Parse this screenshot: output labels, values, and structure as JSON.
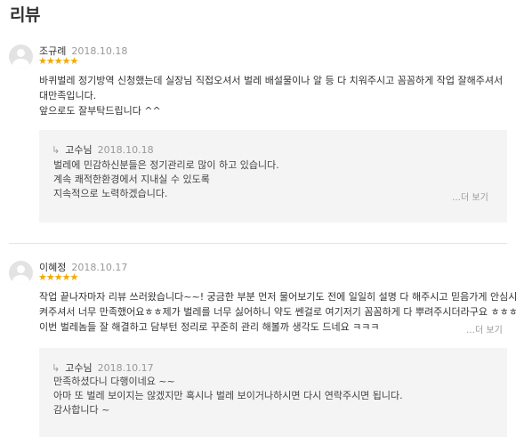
{
  "page": {
    "title": "리뷰"
  },
  "reviews": [
    {
      "author": "조규례",
      "date": "2018.10.18",
      "stars": "★★★★★",
      "lines": [
        "바퀴벌레 정기방역 신청했는데 실장님 직접오셔서 벌레 배설물이나 알 등 다 치워주시고 꼼꼼하게 작업 잘해주셔서",
        "대만족입니다.",
        "앞으로도 잘부탁드립니다 ^^"
      ],
      "reply": {
        "arrow": "↳",
        "author": "고수님",
        "date": "2018.10.18",
        "lines": [
          "벌레에 민감하신분들은 정기관리로 많이 하고 있습니다.",
          "계속 쾌적한환경에서 지내실 수 있도록",
          "지속적으로 노력하겠습니다."
        ],
        "more": "…더 보기"
      }
    },
    {
      "author": "이혜정",
      "date": "2018.10.17",
      "stars": "★★★★★",
      "lines": [
        "작업 끝나자마자 리뷰 쓰러왔습니다~~! 궁금한 부분 먼저 물어보기도 전에 일일히 설명 다 해주시고 믿음가게 안심시",
        "켜주셔서 너무 만족했어요ㅎㅎ제가 벌레를 너무 싫어하니 약도 쎈걸로 여기저기 꼼꼼하게 다 뿌려주시더라구요 ㅎㅎㅎ",
        "이번 벌레놈들 잘 해결하고 담부턴 정리로 꾸준히 관리 해볼까 생각도 드네요 ㅋㅋㅋ"
      ],
      "more": "…더 보기",
      "reply": {
        "arrow": "↳",
        "author": "고수님",
        "date": "2018.10.17",
        "lines": [
          "만족하셨다니 다행이네요 ~~",
          "아마 또 벌레 보이지는 않겠지만 혹시나 벌레 보이거나하시면 다시 연락주시면 됩니다.",
          "감사합니다 ~"
        ]
      }
    }
  ],
  "colors": {
    "star": "#f5a800",
    "muted": "#999999",
    "reply_bg": "#f4f4f4"
  }
}
